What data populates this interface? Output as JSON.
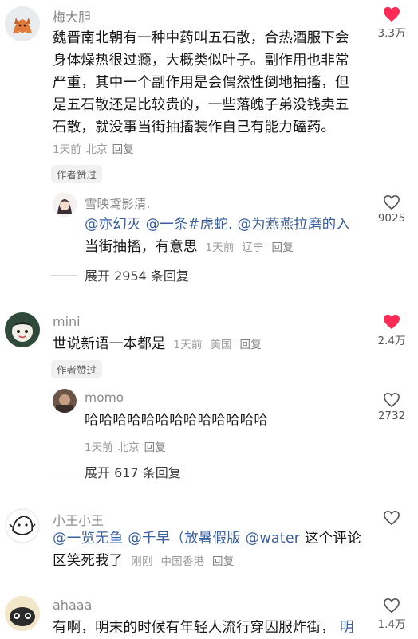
{
  "comments": [
    {
      "username": "梅大胆",
      "lines": [
        "魏晋南北朝有一种中药叫五石散，合热酒服下会",
        "身体燥热很过瘾，大概类似叶子。副作用也非常",
        "严重，其中一个副作用是会偶然性倒地抽搐，但",
        "是五石散还是比较贵的，一些落魄子弟没钱卖五",
        "石散，就没事当街抽搐装作自己有能力磕药。"
      ],
      "time": "1天前",
      "location": "北京",
      "reply_label": "回复",
      "badge": "作者赞过",
      "likes": "3.3万",
      "liked": true,
      "replies": [
        {
          "username": "雪映鸢影清.",
          "line1_mentions": [
            "@亦幻灭",
            "@一条#虎蛇.",
            "@为燕燕拉磨的入"
          ],
          "line2_text": "当街抽搐，有意思",
          "time": "1天前",
          "location": "辽宁",
          "reply_label": "回复",
          "likes": "9025"
        }
      ],
      "expand_label": "展开 2954 条回复"
    },
    {
      "username": "mini",
      "text": "世说新语一本都是",
      "time": "1天前",
      "location": "美国",
      "reply_label": "回复",
      "badge": "作者赞过",
      "likes": "2.4万",
      "liked": true,
      "replies": [
        {
          "username": "momo",
          "text": "哈哈哈哈哈哈哈哈哈哈哈哈哈",
          "time": "1天前",
          "location": "北京",
          "reply_label": "回复",
          "likes": "2732"
        }
      ],
      "expand_label": "展开 617 条回复"
    },
    {
      "username": "小王小王",
      "mentions": [
        "@一览无鱼",
        "@千早（放暑假版",
        "@water"
      ],
      "line1_tail": "这个评论",
      "line2_text": "区笑死我了",
      "time": "刚刚",
      "location": "中国香港",
      "reply_label": "回复",
      "liked": false
    },
    {
      "username": "ahaaa",
      "text": "有啊，明末的时候有年轻人流行穿囚服炸街，",
      "text_tail": "明",
      "likes": "1.4万",
      "liked": false
    }
  ],
  "colors": {
    "like_red": "#fe2c55",
    "mention_blue": "#3b5f9c",
    "meta_gray": "#9a9a9a"
  },
  "icons": {
    "liked": "heart-filled-icon",
    "unliked": "heart-outline-icon"
  }
}
